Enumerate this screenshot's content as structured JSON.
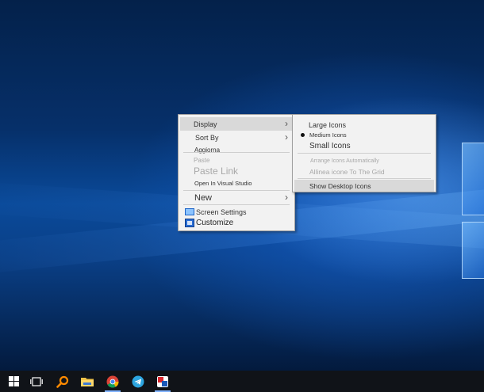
{
  "context_menu": {
    "items": [
      {
        "label": "Display",
        "submenu": true
      },
      {
        "label": "Sort By",
        "submenu": true
      },
      {
        "label": "Aggiorna"
      },
      {
        "label": "Paste",
        "disabled": true
      },
      {
        "label": "Paste Link",
        "disabled": true
      },
      {
        "label": "Open In Visual Studio"
      },
      {
        "label": "New",
        "submenu": true
      },
      {
        "label": "Screen Settings",
        "icon": "monitor-icon"
      },
      {
        "label": "Customize",
        "icon": "customize-icon"
      }
    ]
  },
  "display_submenu": {
    "items": [
      {
        "label": "Large Icons"
      },
      {
        "label": "Medium Icons",
        "selected": true
      },
      {
        "label": "Small Icons"
      },
      {
        "label": "Arrange Icons Automatically",
        "disabled": true
      },
      {
        "label": "Allinea icone To The Grid",
        "disabled": true
      },
      {
        "label": "Show Desktop Icons"
      }
    ]
  },
  "icons": {
    "submenu_arrow": "›"
  },
  "taskbar": {
    "items": [
      "start-icon",
      "task-view-icon",
      "search-icon",
      "file-explorer-icon",
      "chrome-icon",
      "telegram-icon",
      "app-icon"
    ]
  },
  "colors": {
    "menu_bg": "#f2f2f2",
    "menu_highlight": "#d9d9d9",
    "taskbar_bg": "#101318",
    "accent": "#7fb2ff"
  }
}
